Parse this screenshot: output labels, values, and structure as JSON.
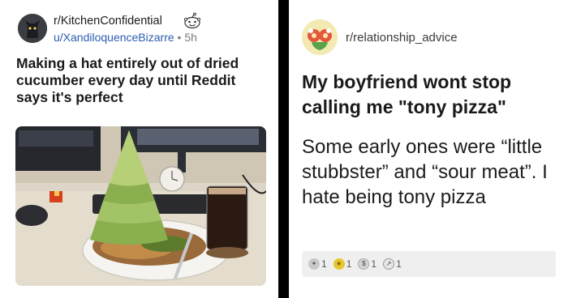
{
  "left_post": {
    "subreddit": "r/KitchenConfidential",
    "username": "u/XandiloquenceBizarre",
    "separator": "•",
    "time": "5h",
    "title": "Making a hat entirely out of dried cucumber every day until Reddit says it's perfect",
    "avatar_icon": "cat-avatar-icon",
    "flair_icon": "snoo-icon"
  },
  "right_post": {
    "subreddit": "r/relationship_advice",
    "avatar_icon": "flowers-avatar-icon",
    "title": "My boyfriend wont stop calling me \"tony pizza\"",
    "body": "Some early ones were “little stubbster” and “sour meat”. I hate being tony pizza",
    "awards": [
      {
        "icon": "silver-award-icon",
        "count": "1"
      },
      {
        "icon": "gold-award-icon",
        "count": "1"
      },
      {
        "icon": "coin-award-icon",
        "count": "1"
      },
      {
        "icon": "helpful-award-icon",
        "count": "1"
      }
    ]
  },
  "colors": {
    "background": "#000000",
    "panel": "#ffffff",
    "username": "#2a5db0",
    "award_bar": "#efefef"
  }
}
